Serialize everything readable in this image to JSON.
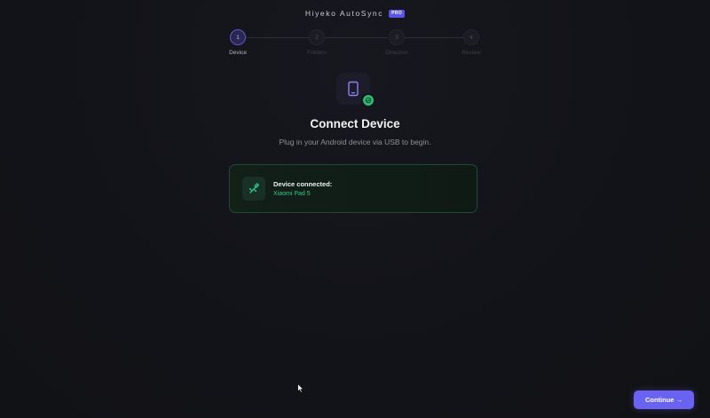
{
  "header": {
    "app_title": "Hiyeko AutoSync",
    "badge": "PRO"
  },
  "stepper": {
    "steps": [
      {
        "number": "1",
        "label": "Device",
        "active": true
      },
      {
        "number": "2",
        "label": "Folders",
        "active": false
      },
      {
        "number": "3",
        "label": "Direction",
        "active": false
      },
      {
        "number": "4",
        "label": "Review",
        "active": false
      }
    ]
  },
  "hero": {
    "icon": "tablet-icon",
    "badge_icon": "check-icon",
    "title": "Connect Device",
    "subtitle": "Plug in your Android device via USB to begin."
  },
  "status_card": {
    "icon": "usb-icon",
    "title": "Device connected:",
    "device_name": "Xiaomi Pad 5"
  },
  "actions": {
    "continue_label": "Continue →"
  },
  "colors": {
    "accent": "#6a62f0",
    "success": "#33c785",
    "background": "#131419"
  }
}
